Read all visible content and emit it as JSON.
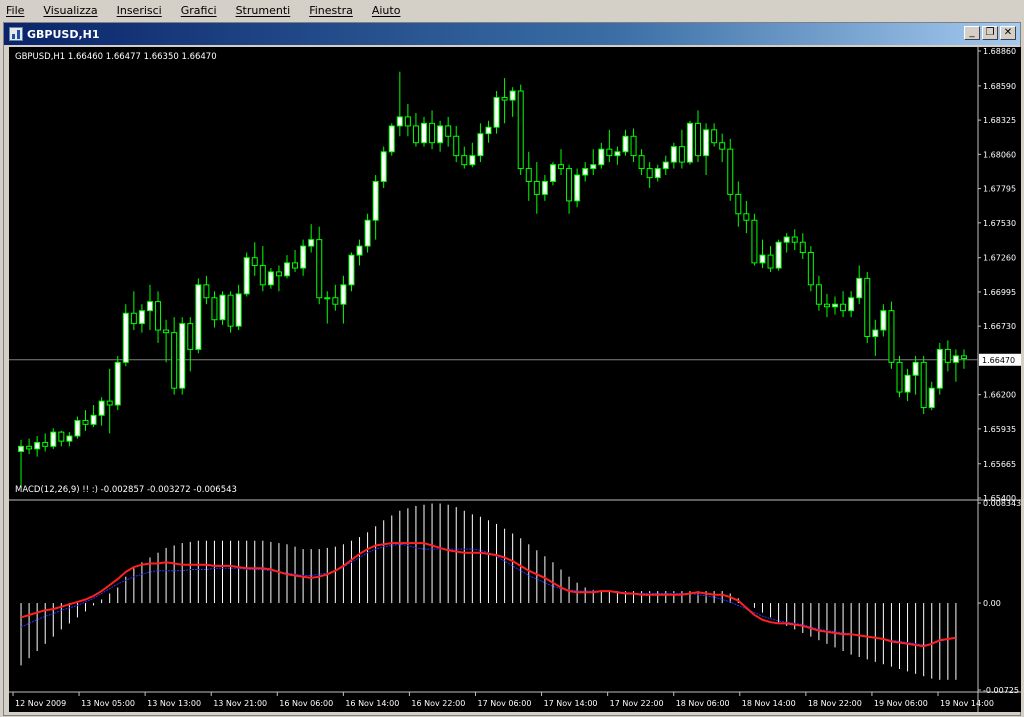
{
  "menu": [
    "File",
    "Visualizza",
    "Inserisci",
    "Grafici",
    "Strumenti",
    "Finestra",
    "Aiuto"
  ],
  "window": {
    "title": "GBPUSD,H1",
    "buttons": {
      "minimize": "_",
      "restore": "❐",
      "close": "✕"
    }
  },
  "price_panel": {
    "header": "GBPUSD,H1  1.66460 1.66477 1.66350 1.66470",
    "current_price": "1.66470",
    "y_ticks": [
      "1.68860",
      "1.68590",
      "1.68325",
      "1.68060",
      "1.67795",
      "1.67530",
      "1.67260",
      "1.66995",
      "1.66730",
      "1.66200",
      "1.65935",
      "1.65665",
      "1.65400"
    ]
  },
  "macd_panel": {
    "header": "MACD(12,26,9)    !! :) -0.002857 -0.003272 -0.006543",
    "y_ticks": [
      "0.008343",
      "0.00",
      "-0.00725"
    ]
  },
  "x_ticks": [
    "12 Nov 2009",
    "13 Nov 05:00",
    "13 Nov 13:00",
    "13 Nov 21:00",
    "16 Nov 06:00",
    "16 Nov 14:00",
    "16 Nov 22:00",
    "17 Nov 06:00",
    "17 Nov 14:00",
    "17 Nov 22:00",
    "18 Nov 06:00",
    "18 Nov 14:00",
    "18 Nov 22:00",
    "19 Nov 06:00",
    "19 Nov 14:00"
  ],
  "colors": {
    "background": "#000000",
    "bull_candle": "#ffffff",
    "candle_outline": "#00ff00",
    "macd_histogram": "#ffffff",
    "signal_line": "#ff2020",
    "macd_line": "#3030ff",
    "price_line": "#808080"
  },
  "chart_data": [
    {
      "type": "candlestick",
      "title": "GBPUSD,H1",
      "ylim": [
        1.654,
        1.6886
      ],
      "candles": [
        [
          1.6576,
          1.6585,
          1.6548,
          1.658
        ],
        [
          1.658,
          1.6586,
          1.6574,
          1.6578
        ],
        [
          1.6578,
          1.6588,
          1.6572,
          1.6583
        ],
        [
          1.6583,
          1.659,
          1.6576,
          1.658
        ],
        [
          1.658,
          1.6594,
          1.6578,
          1.6591
        ],
        [
          1.6591,
          1.6592,
          1.658,
          1.6584
        ],
        [
          1.6584,
          1.6591,
          1.658,
          1.6588
        ],
        [
          1.6588,
          1.6603,
          1.6586,
          1.66
        ],
        [
          1.66,
          1.6608,
          1.6592,
          1.6597
        ],
        [
          1.6597,
          1.6612,
          1.6595,
          1.6604
        ],
        [
          1.6604,
          1.6618,
          1.6596,
          1.6615
        ],
        [
          1.6615,
          1.664,
          1.659,
          1.6612
        ],
        [
          1.6612,
          1.665,
          1.6608,
          1.6645
        ],
        [
          1.6645,
          1.669,
          1.6642,
          1.6683
        ],
        [
          1.6683,
          1.67,
          1.667,
          1.6675
        ],
        [
          1.6675,
          1.669,
          1.6668,
          1.6685
        ],
        [
          1.6685,
          1.6705,
          1.667,
          1.6692
        ],
        [
          1.6692,
          1.67,
          1.666,
          1.667
        ],
        [
          1.667,
          1.6678,
          1.6645,
          1.6668
        ],
        [
          1.6668,
          1.668,
          1.662,
          1.6625
        ],
        [
          1.6625,
          1.668,
          1.662,
          1.6675
        ],
        [
          1.6675,
          1.668,
          1.6638,
          1.6655
        ],
        [
          1.6655,
          1.671,
          1.6652,
          1.6705
        ],
        [
          1.6705,
          1.6712,
          1.669,
          1.6695
        ],
        [
          1.6695,
          1.67,
          1.6672,
          1.6678
        ],
        [
          1.6678,
          1.67,
          1.6674,
          1.6697
        ],
        [
          1.6697,
          1.67,
          1.6668,
          1.6673
        ],
        [
          1.6673,
          1.6705,
          1.667,
          1.6698
        ],
        [
          1.6698,
          1.673,
          1.6696,
          1.6726
        ],
        [
          1.6726,
          1.6738,
          1.6712,
          1.672
        ],
        [
          1.672,
          1.6735,
          1.67,
          1.6705
        ],
        [
          1.6705,
          1.6718,
          1.6702,
          1.6715
        ],
        [
          1.6715,
          1.672,
          1.67,
          1.6712
        ],
        [
          1.6712,
          1.6728,
          1.671,
          1.6722
        ],
        [
          1.6722,
          1.6732,
          1.6715,
          1.6718
        ],
        [
          1.6718,
          1.674,
          1.6712,
          1.6735
        ],
        [
          1.6735,
          1.6752,
          1.673,
          1.674
        ],
        [
          1.674,
          1.675,
          1.669,
          1.6695
        ],
        [
          1.6695,
          1.67,
          1.6675,
          1.6695
        ],
        [
          1.6695,
          1.6705,
          1.6685,
          1.669
        ],
        [
          1.669,
          1.6712,
          1.6675,
          1.6705
        ],
        [
          1.6705,
          1.673,
          1.67,
          1.6728
        ],
        [
          1.6728,
          1.674,
          1.672,
          1.6735
        ],
        [
          1.6735,
          1.676,
          1.673,
          1.6755
        ],
        [
          1.6755,
          1.679,
          1.674,
          1.6785
        ],
        [
          1.6785,
          1.6812,
          1.678,
          1.6808
        ],
        [
          1.6808,
          1.683,
          1.6805,
          1.6828
        ],
        [
          1.6828,
          1.687,
          1.682,
          1.6835
        ],
        [
          1.6835,
          1.6845,
          1.682,
          1.6828
        ],
        [
          1.6828,
          1.6838,
          1.6812,
          1.6815
        ],
        [
          1.6815,
          1.6835,
          1.6812,
          1.683
        ],
        [
          1.683,
          1.684,
          1.681,
          1.6815
        ],
        [
          1.6815,
          1.6832,
          1.6808,
          1.6828
        ],
        [
          1.6828,
          1.6835,
          1.6812,
          1.682
        ],
        [
          1.682,
          1.6828,
          1.68,
          1.6805
        ],
        [
          1.6805,
          1.6812,
          1.6795,
          1.6798
        ],
        [
          1.6798,
          1.6815,
          1.6796,
          1.6805
        ],
        [
          1.6805,
          1.683,
          1.68,
          1.6822
        ],
        [
          1.6822,
          1.6832,
          1.6815,
          1.6827
        ],
        [
          1.6827,
          1.6855,
          1.6822,
          1.685
        ],
        [
          1.685,
          1.6865,
          1.683,
          1.6848
        ],
        [
          1.6848,
          1.6858,
          1.6835,
          1.6855
        ],
        [
          1.6855,
          1.686,
          1.679,
          1.6795
        ],
        [
          1.6795,
          1.6808,
          1.677,
          1.6785
        ],
        [
          1.6785,
          1.68,
          1.676,
          1.6775
        ],
        [
          1.6775,
          1.679,
          1.677,
          1.6785
        ],
        [
          1.6785,
          1.68,
          1.6782,
          1.6798
        ],
        [
          1.6798,
          1.681,
          1.679,
          1.6795
        ],
        [
          1.6795,
          1.6798,
          1.676,
          1.677
        ],
        [
          1.677,
          1.6795,
          1.6765,
          1.679
        ],
        [
          1.679,
          1.68,
          1.6785,
          1.6795
        ],
        [
          1.6795,
          1.681,
          1.679,
          1.6798
        ],
        [
          1.6798,
          1.6815,
          1.6795,
          1.681
        ],
        [
          1.681,
          1.6825,
          1.68,
          1.6805
        ],
        [
          1.6805,
          1.6812,
          1.6798,
          1.6808
        ],
        [
          1.6808,
          1.6825,
          1.6805,
          1.682
        ],
        [
          1.682,
          1.6826,
          1.68,
          1.6805
        ],
        [
          1.6805,
          1.681,
          1.679,
          1.6795
        ],
        [
          1.6795,
          1.68,
          1.678,
          1.6788
        ],
        [
          1.6788,
          1.6798,
          1.6785,
          1.6795
        ],
        [
          1.6795,
          1.6805,
          1.679,
          1.68
        ],
        [
          1.68,
          1.6815,
          1.6795,
          1.6812
        ],
        [
          1.6812,
          1.6825,
          1.6795,
          1.68
        ],
        [
          1.68,
          1.6832,
          1.6798,
          1.683
        ],
        [
          1.683,
          1.684,
          1.68,
          1.6805
        ],
        [
          1.6805,
          1.683,
          1.679,
          1.6825
        ],
        [
          1.6825,
          1.683,
          1.6812,
          1.6815
        ],
        [
          1.6815,
          1.6822,
          1.68,
          1.681
        ],
        [
          1.681,
          1.6818,
          1.677,
          1.6775
        ],
        [
          1.6775,
          1.6785,
          1.675,
          1.676
        ],
        [
          1.676,
          1.677,
          1.6745,
          1.6755
        ],
        [
          1.6755,
          1.676,
          1.672,
          1.6722
        ],
        [
          1.6722,
          1.674,
          1.6718,
          1.6728
        ],
        [
          1.6728,
          1.6735,
          1.6715,
          1.6718
        ],
        [
          1.6718,
          1.674,
          1.6716,
          1.6738
        ],
        [
          1.6738,
          1.6745,
          1.673,
          1.6742
        ],
        [
          1.6742,
          1.6748,
          1.6732,
          1.6738
        ],
        [
          1.6738,
          1.6745,
          1.6725,
          1.673
        ],
        [
          1.673,
          1.6735,
          1.67,
          1.6705
        ],
        [
          1.6705,
          1.6712,
          1.6685,
          1.669
        ],
        [
          1.669,
          1.6698,
          1.668,
          1.6688
        ],
        [
          1.6688,
          1.6696,
          1.6682,
          1.669
        ],
        [
          1.669,
          1.67,
          1.668,
          1.6685
        ],
        [
          1.6685,
          1.67,
          1.668,
          1.6695
        ],
        [
          1.6695,
          1.672,
          1.669,
          1.671
        ],
        [
          1.671,
          1.6715,
          1.666,
          1.6665
        ],
        [
          1.6665,
          1.6678,
          1.665,
          1.667
        ],
        [
          1.667,
          1.669,
          1.6665,
          1.6685
        ],
        [
          1.6685,
          1.6692,
          1.664,
          1.6645
        ],
        [
          1.6645,
          1.665,
          1.6618,
          1.6622
        ],
        [
          1.6622,
          1.664,
          1.6615,
          1.6635
        ],
        [
          1.6635,
          1.665,
          1.662,
          1.6645
        ],
        [
          1.6645,
          1.665,
          1.6605,
          1.661
        ],
        [
          1.661,
          1.663,
          1.6608,
          1.6625
        ],
        [
          1.6625,
          1.666,
          1.662,
          1.6655
        ],
        [
          1.6655,
          1.6662,
          1.6638,
          1.6645
        ],
        [
          1.6645,
          1.6655,
          1.663,
          1.665
        ],
        [
          1.665,
          1.6655,
          1.664,
          1.6648
        ]
      ]
    },
    {
      "type": "macd",
      "title": "MACD(12,26,9)",
      "ylim": [
        -0.00725,
        0.008343
      ],
      "histogram": [
        -0.0052,
        -0.0046,
        -0.004,
        -0.0034,
        -0.0028,
        -0.0022,
        -0.0017,
        -0.0012,
        -0.0007,
        -0.0002,
        0.0003,
        0.0008,
        0.0013,
        0.0022,
        0.0029,
        0.0034,
        0.0038,
        0.0042,
        0.0046,
        0.0048,
        0.005,
        0.0051,
        0.0052,
        0.0052,
        0.0052,
        0.0052,
        0.0052,
        0.0052,
        0.0052,
        0.0052,
        0.0052,
        0.0051,
        0.005,
        0.0049,
        0.0047,
        0.0045,
        0.0045,
        0.0045,
        0.0046,
        0.0047,
        0.0049,
        0.0052,
        0.0055,
        0.0059,
        0.0064,
        0.0069,
        0.0073,
        0.0077,
        0.0079,
        0.0081,
        0.0082,
        0.0083,
        0.0083,
        0.0082,
        0.008,
        0.0077,
        0.0074,
        0.0072,
        0.0069,
        0.0066,
        0.0062,
        0.0058,
        0.0054,
        0.0049,
        0.0044,
        0.0039,
        0.0034,
        0.0028,
        0.0022,
        0.0017,
        0.0013,
        0.0011,
        0.001,
        0.001,
        0.001,
        0.001,
        0.001,
        0.001,
        0.001,
        0.001,
        0.001,
        0.001,
        0.001,
        0.001,
        0.001,
        0.001,
        0.001,
        0.001,
        0.0008,
        0.0004,
        0.0,
        -0.0004,
        -0.0008,
        -0.0012,
        -0.0016,
        -0.0019,
        -0.0022,
        -0.0025,
        -0.0028,
        -0.0031,
        -0.0034,
        -0.0037,
        -0.004,
        -0.0043,
        -0.0045,
        -0.0047,
        -0.0049,
        -0.0051,
        -0.0053,
        -0.0055,
        -0.0057,
        -0.0059,
        -0.0061,
        -0.0063,
        -0.0064,
        -0.0064,
        -0.0064
      ],
      "signal": [
        -0.0012,
        -0.001,
        -0.0008,
        -0.0006,
        -0.0005,
        -0.0003,
        -0.0001,
        0.0001,
        0.0003,
        0.0006,
        0.001,
        0.0015,
        0.002,
        0.0026,
        0.003,
        0.0032,
        0.0033,
        0.0033,
        0.0034,
        0.0033,
        0.0032,
        0.0032,
        0.0032,
        0.0032,
        0.0031,
        0.0031,
        0.0031,
        0.003,
        0.0029,
        0.0029,
        0.0029,
        0.0028,
        0.0026,
        0.0024,
        0.0023,
        0.0022,
        0.0021,
        0.0022,
        0.0024,
        0.0027,
        0.0031,
        0.0036,
        0.0041,
        0.0045,
        0.0048,
        0.0049,
        0.005,
        0.005,
        0.005,
        0.005,
        0.005,
        0.0048,
        0.0046,
        0.0044,
        0.0043,
        0.0042,
        0.0042,
        0.0042,
        0.0041,
        0.004,
        0.0038,
        0.0035,
        0.0031,
        0.0027,
        0.0024,
        0.0021,
        0.0017,
        0.0013,
        0.001,
        0.0009,
        0.0009,
        0.0009,
        0.001,
        0.001,
        0.0009,
        0.0008,
        0.0008,
        0.0007,
        0.0007,
        0.0007,
        0.0007,
        0.0007,
        0.0007,
        0.0008,
        0.0009,
        0.0008,
        0.0007,
        0.0007,
        0.0005,
        0.0002,
        -0.0004,
        -0.001,
        -0.0014,
        -0.0016,
        -0.0017,
        -0.0017,
        -0.0018,
        -0.0019,
        -0.0021,
        -0.0023,
        -0.0024,
        -0.0025,
        -0.0026,
        -0.0026,
        -0.0027,
        -0.0028,
        -0.0029,
        -0.003,
        -0.0032,
        -0.0033,
        -0.0034,
        -0.0035,
        -0.0036,
        -0.0034,
        -0.0031,
        -0.003,
        -0.0029
      ],
      "macd": [
        -0.002,
        -0.0017,
        -0.0014,
        -0.0011,
        -0.0009,
        -0.0006,
        -0.0004,
        -0.0002,
        0.0001,
        0.0004,
        0.0008,
        0.0012,
        0.0016,
        0.0019,
        0.0022,
        0.0024,
        0.0026,
        0.0027,
        0.0027,
        0.0027,
        0.0027,
        0.0028,
        0.0028,
        0.0028,
        0.0029,
        0.0029,
        0.0029,
        0.0029,
        0.0028,
        0.0028,
        0.0028,
        0.0027,
        0.0026,
        0.0025,
        0.0024,
        0.0023,
        0.0023,
        0.0024,
        0.0025,
        0.0027,
        0.003,
        0.0034,
        0.0038,
        0.0042,
        0.0045,
        0.0047,
        0.0048,
        0.0049,
        0.0048,
        0.0046,
        0.0045,
        0.0045,
        0.0045,
        0.0045,
        0.0045,
        0.0045,
        0.0045,
        0.0044,
        0.0042,
        0.0039,
        0.0035,
        0.0031,
        0.0027,
        0.0023,
        0.002,
        0.0017,
        0.0014,
        0.0012,
        0.0011,
        0.001,
        0.001,
        0.001,
        0.001,
        0.001,
        0.0009,
        0.0009,
        0.0008,
        0.0008,
        0.0008,
        0.0008,
        0.0008,
        0.0008,
        0.0008,
        0.0008,
        0.0007,
        0.0006,
        0.0005,
        0.0003,
        0.0001,
        -0.0002,
        -0.0005,
        -0.0008,
        -0.0011,
        -0.0013,
        -0.0015,
        -0.0016,
        -0.0017,
        -0.0018,
        -0.002,
        -0.0022,
        -0.0023,
        -0.0024,
        -0.0025,
        -0.0026,
        -0.0027,
        -0.0028,
        -0.0029,
        -0.003,
        -0.0031,
        -0.0032,
        -0.0033,
        -0.0034,
        -0.0035,
        -0.0034,
        -0.0032,
        -0.003,
        -0.0029
      ]
    }
  ]
}
